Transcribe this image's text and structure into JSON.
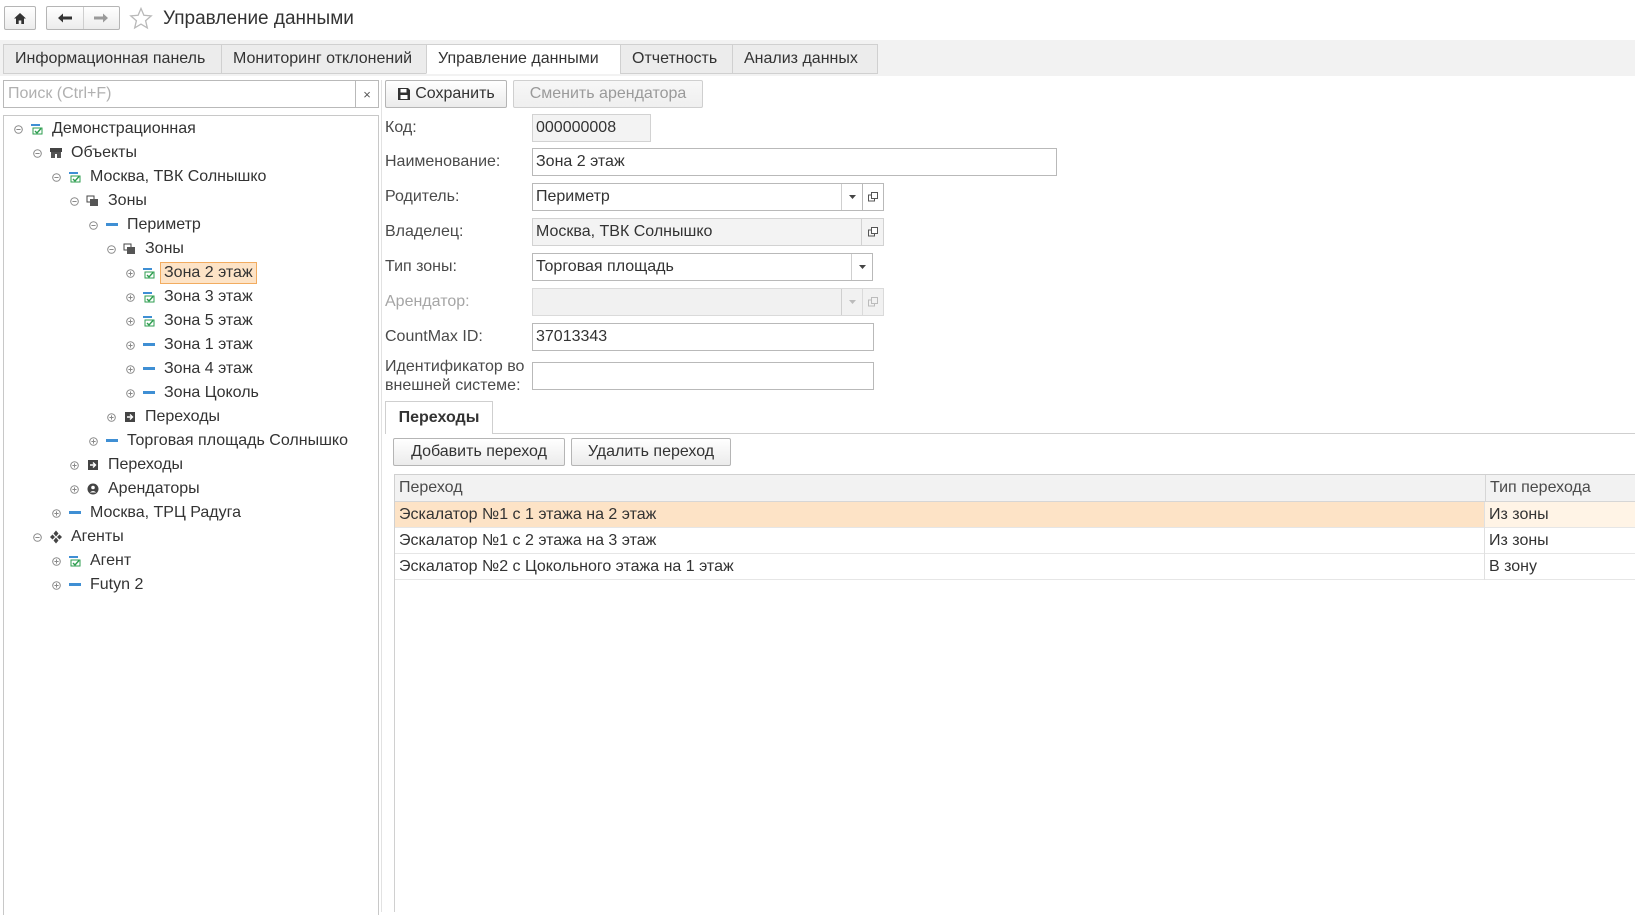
{
  "window": {
    "title": "Управление данными"
  },
  "sections": [
    {
      "label": "Информационная панель",
      "active": false
    },
    {
      "label": "Мониторинг отклонений",
      "active": false
    },
    {
      "label": "Управление данными",
      "active": true
    },
    {
      "label": "Отчетность",
      "active": false
    },
    {
      "label": "Анализ данных",
      "active": false
    }
  ],
  "search": {
    "placeholder": "Поиск (Ctrl+F)",
    "value": "",
    "clear": "×"
  },
  "tree": [
    {
      "label": "Демонстрационная",
      "toggle": "minus",
      "icon": "green-folder-icon"
    },
    {
      "label": "Объекты",
      "toggle": "minus",
      "icon": "building-icon"
    },
    {
      "label": "Москва, ТВК Солнышко",
      "toggle": "minus",
      "icon": "green-folder-icon"
    },
    {
      "label": "Зоны",
      "toggle": "minus",
      "icon": "stack-icon"
    },
    {
      "label": "Периметр",
      "toggle": "minus",
      "icon": "dash-icon"
    },
    {
      "label": "Зоны",
      "toggle": "minus",
      "icon": "stack-icon"
    },
    {
      "label": "Зона 2 этаж",
      "toggle": "plus",
      "icon": "green-folder-icon",
      "selected": true
    },
    {
      "label": "Зона 3 этаж",
      "toggle": "plus",
      "icon": "green-folder-icon"
    },
    {
      "label": "Зона 5 этаж",
      "toggle": "plus",
      "icon": "green-folder-icon"
    },
    {
      "label": "Зона 1 этаж",
      "toggle": "plus",
      "icon": "dash-icon"
    },
    {
      "label": "Зона 4 этаж",
      "toggle": "plus",
      "icon": "dash-icon"
    },
    {
      "label": "Зона Цоколь",
      "toggle": "plus",
      "icon": "dash-icon"
    },
    {
      "label": "Переходы",
      "toggle": "plus",
      "icon": "transition-icon"
    },
    {
      "label": "Торговая площадь Солнышко",
      "toggle": "plus",
      "icon": "dash-icon"
    },
    {
      "label": "Переходы",
      "toggle": "plus",
      "icon": "transition-icon"
    },
    {
      "label": "Арендаторы",
      "toggle": "plus",
      "icon": "person-icon"
    },
    {
      "label": "Москва, ТРЦ Радуга",
      "toggle": "plus",
      "icon": "dash-icon"
    },
    {
      "label": "Агенты",
      "toggle": "minus",
      "icon": "agents-icon"
    },
    {
      "label": "Агент",
      "toggle": "plus",
      "icon": "green-folder-icon"
    },
    {
      "label": "Futyn 2",
      "toggle": "plus",
      "icon": "dash-icon"
    }
  ],
  "toolbar": {
    "save": "Сохранить",
    "change_tenant": "Сменить арендатора"
  },
  "form": {
    "code": {
      "label": "Код:",
      "value": "000000008"
    },
    "name": {
      "label": "Наименование:",
      "value": "Зона 2 этаж"
    },
    "parent": {
      "label": "Родитель:",
      "value": "Периметр"
    },
    "owner": {
      "label": "Владелец:",
      "value": "Москва, ТВК Солнышко"
    },
    "zone_type": {
      "label": "Тип зоны:",
      "value": "Торговая площадь"
    },
    "tenant": {
      "label": "Арендатор:",
      "value": ""
    },
    "countmax": {
      "label": "CountMax ID:",
      "value": "37013343"
    },
    "external_id": {
      "label_line1": "Идентификатор во",
      "label_line2": "внешней системе:",
      "value": ""
    }
  },
  "transitions": {
    "tab_label": "Переходы",
    "add_button": "Добавить переход",
    "delete_button": "Удалить переход",
    "columns": [
      "Переход",
      "Тип перехода"
    ],
    "rows": [
      {
        "transition": "Эскалатор №1 с 1 этажа на 2 этаж",
        "type": "Из зоны",
        "selected": true
      },
      {
        "transition": "Эскалатор №1 с 2 этажа на 3 этаж",
        "type": "Из зоны",
        "selected": false
      },
      {
        "transition": "Эскалатор №2 с Цокольного этажа на 1 этаж",
        "type": "В зону",
        "selected": false
      }
    ]
  },
  "colors": {
    "selection_bg": "#fde3c6",
    "selection_border": "#f2ac60",
    "tree_icon_green": "#2e9e4f",
    "tree_icon_blue": "#3f8fd4"
  }
}
